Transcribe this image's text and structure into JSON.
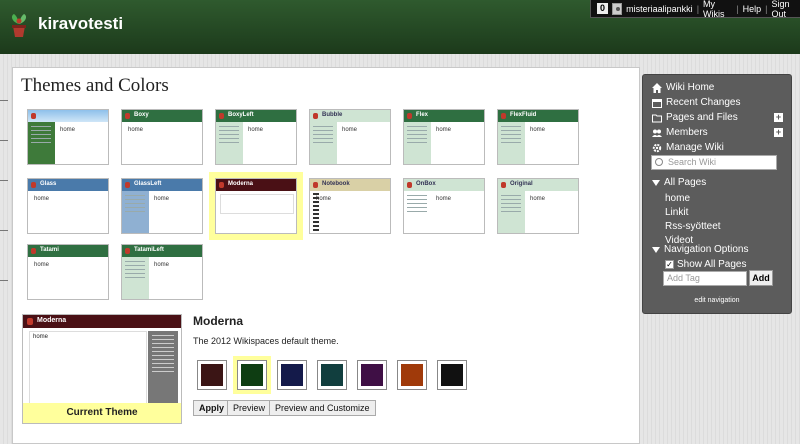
{
  "header": {
    "site_title": "kiravotesti",
    "message_count": "0",
    "username": "misteriaalipankki",
    "links": [
      "My Wikis",
      "Help",
      "Sign Out"
    ]
  },
  "main": {
    "title": "Themes and Colors",
    "themes": [
      {
        "name": "",
        "bar": "#d8dfe6",
        "side": "#ffffff",
        "sky": true
      },
      {
        "name": "Boxy",
        "bar": "#2f6f41",
        "side": "#ffffff"
      },
      {
        "name": "BoxyLeft",
        "bar": "#2f6f41",
        "side": "#cfe4d3"
      },
      {
        "name": "Bubble",
        "bar": "#cfe4d3",
        "side": "#cfe4d3"
      },
      {
        "name": "Flex",
        "bar": "#2f6f41",
        "side": "#cfe4d3"
      },
      {
        "name": "FlexFluid",
        "bar": "#2f6f41",
        "side": "#cfe4d3"
      },
      {
        "name": "Glass",
        "bar": "#4a7aaa",
        "side": "#ffffff"
      },
      {
        "name": "GlassLeft",
        "bar": "#4a7aaa",
        "side": "#8fb0d2"
      },
      {
        "name": "Moderna",
        "bar": "#4a1015",
        "side": "#ffffff",
        "selected": true
      },
      {
        "name": "Notebook",
        "bar": "#d9d0a6",
        "side": "#ffffff"
      },
      {
        "name": "OnBox",
        "bar": "#cfe4d3",
        "side": "#ffffff"
      },
      {
        "name": "Original",
        "bar": "#cfe4d3",
        "side": "#cfe4d3"
      },
      {
        "name": "Tatami",
        "bar": "#2f6f41",
        "side": "#ffffff"
      },
      {
        "name": "TatamiLeft",
        "bar": "#2f6f41",
        "side": "#cfe4d3"
      }
    ],
    "thumb_home": "home",
    "current_theme": {
      "name": "Moderna",
      "label": "Current Theme",
      "description": "The 2012 Wikispaces default theme.",
      "preview_home": "home"
    },
    "colors": [
      "#3b1515",
      "#0e3d12",
      "#141a4a",
      "#113e3e",
      "#3f0f45",
      "#a03a0a",
      "#111111"
    ],
    "selected_color_index": 1,
    "buttons": {
      "apply": "Apply",
      "preview": "Preview",
      "preview_customize": "Preview and Customize"
    }
  },
  "sidebar": {
    "nav": [
      {
        "label": "Wiki Home",
        "icon": "home-icon"
      },
      {
        "label": "Recent Changes",
        "icon": "calendar-icon"
      },
      {
        "label": "Pages and Files",
        "icon": "folder-icon",
        "plus": true
      },
      {
        "label": "Members",
        "icon": "members-icon",
        "plus": true
      },
      {
        "label": "Manage Wiki",
        "icon": "gear-icon"
      }
    ],
    "search_placeholder": "Search Wiki",
    "all_pages_label": "All Pages",
    "pages": [
      "home",
      "Linkit",
      "Rss-syötteet",
      "Videot"
    ],
    "navigation_options_label": "Navigation Options",
    "show_all_pages": "Show All Pages",
    "add_tag_placeholder": "Add Tag",
    "add_button": "Add",
    "edit_navigation": "edit navigation"
  }
}
